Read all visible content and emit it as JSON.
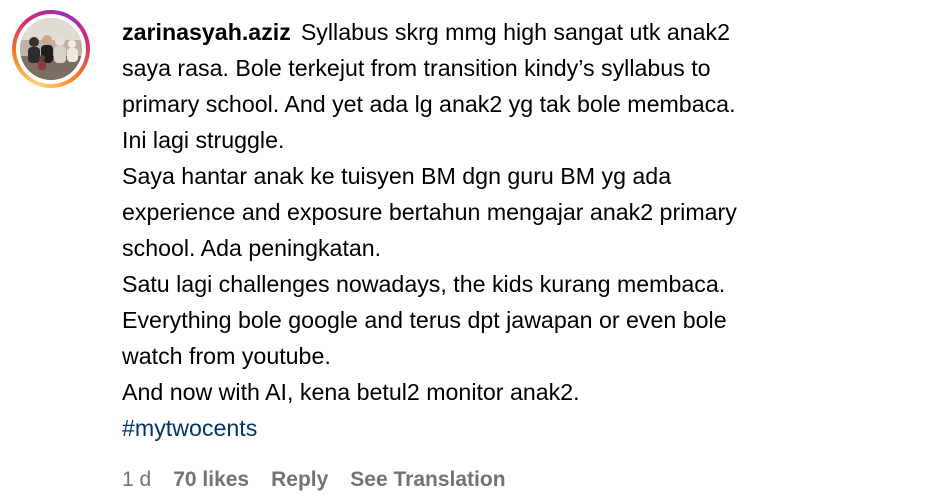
{
  "comment": {
    "username": "zarinasyah.aziz",
    "lines": [
      "Syllabus skrg mmg high sangat utk anak2",
      "saya rasa. Bole terkejut from transition kindy’s syllabus to",
      "primary school. And yet ada lg anak2 yg tak bole membaca.",
      "Ini lagi struggle.",
      "Saya hantar anak ke tuisyen BM dgn guru BM yg ada",
      "experience and exposure bertahun mengajar anak2 primary",
      "school. Ada peningkatan.",
      "Satu lagi challenges nowadays, the kids kurang membaca.",
      "Everything bole google and terus dpt jawapan or even bole",
      "watch from youtube.",
      "And now with AI, kena betul2 monitor anak2."
    ],
    "hashtag": "#mytwocents"
  },
  "meta": {
    "time": "1 d",
    "likes": "70 likes",
    "reply": "Reply",
    "see_translation": "See Translation"
  },
  "colors": {
    "text": "#000000",
    "muted": "#737373",
    "hashtag": "#00376b",
    "story_ring": [
      "#feda75",
      "#fa7e1e",
      "#d62976",
      "#962fbf"
    ]
  },
  "icons": {
    "avatar": "profile-photo-avatar"
  }
}
